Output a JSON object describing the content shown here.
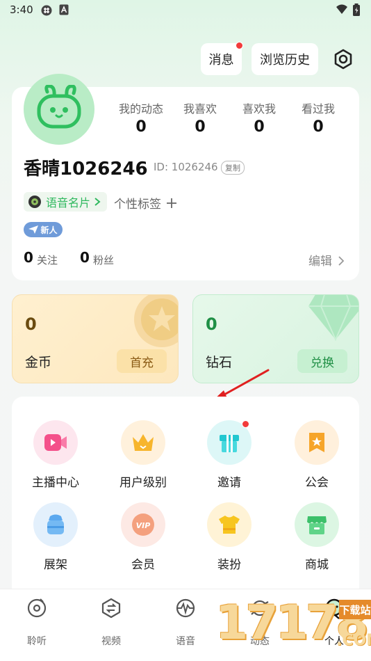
{
  "status_bar": {
    "time": "3:40"
  },
  "header": {
    "messages_label": "消息",
    "history_label": "浏览历史"
  },
  "profile": {
    "stats": [
      {
        "label": "我的动态",
        "value": "0"
      },
      {
        "label": "我喜欢",
        "value": "0"
      },
      {
        "label": "喜欢我",
        "value": "0"
      },
      {
        "label": "看过我",
        "value": "0"
      }
    ],
    "username": "香晴1026246",
    "user_id": "ID: 1026246",
    "copy_label": "复制",
    "voice_card_label": "语音名片",
    "tag_placeholder": "个性标签",
    "badge": "新人",
    "following_count": "0",
    "following_label": "关注",
    "followers_count": "0",
    "followers_label": "粉丝",
    "edit_label": "编辑"
  },
  "wallet": {
    "coins": {
      "value": "0",
      "label": "金币",
      "button": "首充"
    },
    "diamonds": {
      "value": "0",
      "label": "钻石",
      "button": "兑换"
    }
  },
  "services": [
    {
      "label": "主播中心",
      "icon": "anchor-video-icon"
    },
    {
      "label": "用户级别",
      "icon": "crown-icon"
    },
    {
      "label": "邀请",
      "icon": "gift-icon"
    },
    {
      "label": "公会",
      "icon": "guild-badge-icon"
    },
    {
      "label": "展架",
      "icon": "backpack-icon"
    },
    {
      "label": "会员",
      "icon": "vip-icon"
    },
    {
      "label": "装扮",
      "icon": "shirt-icon"
    },
    {
      "label": "商城",
      "icon": "shop-icon"
    }
  ],
  "bottom_nav": [
    {
      "label": "聆听",
      "icon": "music-disc-icon"
    },
    {
      "label": "视频",
      "icon": "video-swap-icon"
    },
    {
      "label": "语音",
      "icon": "voice-wave-icon"
    },
    {
      "label": "动态",
      "icon": "planet-icon"
    },
    {
      "label": "个人",
      "icon": "person-icon"
    }
  ],
  "watermark": {
    "number": "17178",
    "site": "下载站",
    "domain": ".COM"
  },
  "colors": {
    "accent_green": "#2fb85e",
    "notification_red": "#f23b3b",
    "badge_blue": "#6f9bd9"
  }
}
